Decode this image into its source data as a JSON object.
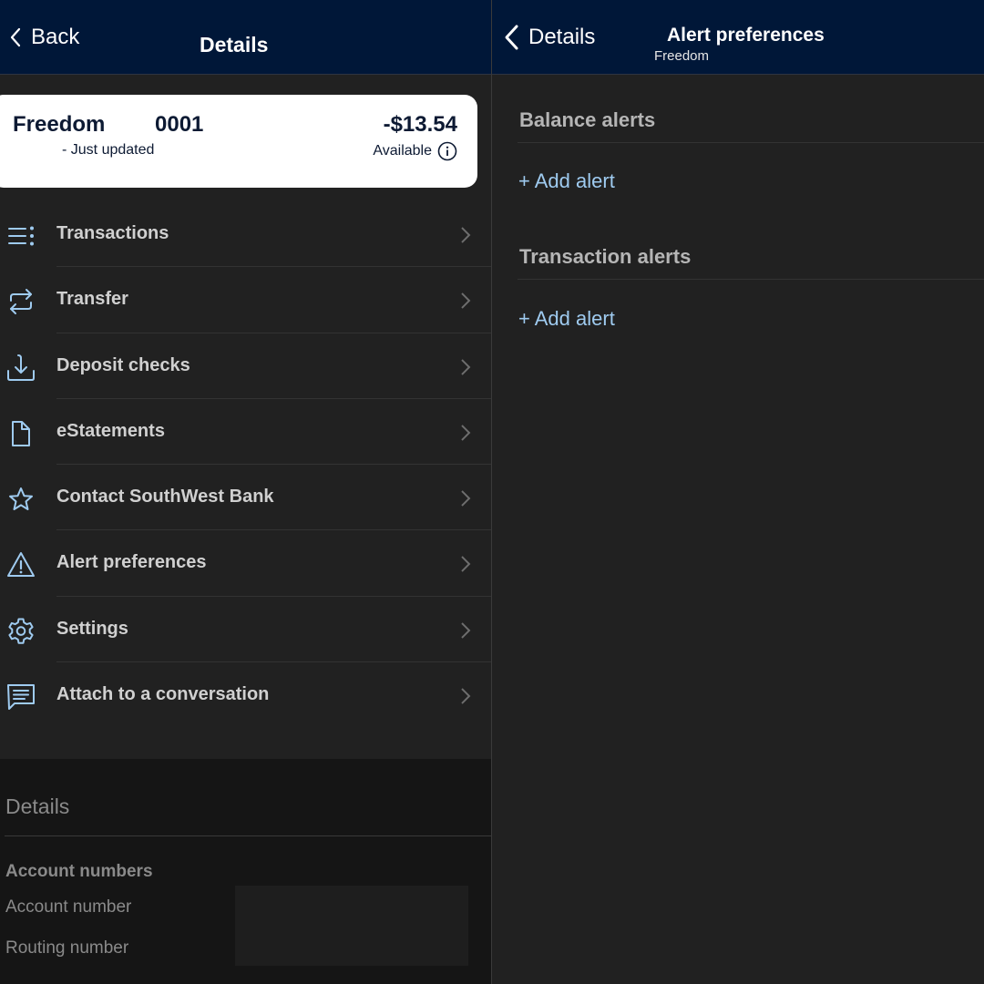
{
  "left": {
    "nav": {
      "back_label": "Back",
      "title": "Details"
    },
    "account_card": {
      "name": "Freedom",
      "number": "0001",
      "status": "- Just updated",
      "balance": "-$13.54",
      "balance_label": "Available"
    },
    "menu": [
      {
        "label": "Transactions",
        "icon": "list-icon"
      },
      {
        "label": "Transfer",
        "icon": "transfer-icon"
      },
      {
        "label": "Deposit checks",
        "icon": "download-icon"
      },
      {
        "label": "eStatements",
        "icon": "document-icon"
      },
      {
        "label": "Contact SouthWest Bank",
        "icon": "star-icon"
      },
      {
        "label": "Alert preferences",
        "icon": "warning-icon"
      },
      {
        "label": "Settings",
        "icon": "gear-icon"
      },
      {
        "label": "Attach to a conversation",
        "icon": "chat-icon"
      }
    ],
    "details": {
      "title": "Details",
      "section": "Account numbers",
      "account_number_label": "Account number",
      "routing_number_label": "Routing number"
    }
  },
  "right": {
    "nav": {
      "back_label": "Details",
      "title": "Alert preferences",
      "subtitle": "Freedom"
    },
    "sections": [
      {
        "title": "Balance alerts",
        "action": "+ Add alert"
      },
      {
        "title": "Transaction alerts",
        "action": "+ Add alert"
      }
    ]
  },
  "colors": {
    "navbar": "#001738",
    "accent": "#9fcbf0",
    "card": "#ffffff",
    "background": "#212121"
  }
}
